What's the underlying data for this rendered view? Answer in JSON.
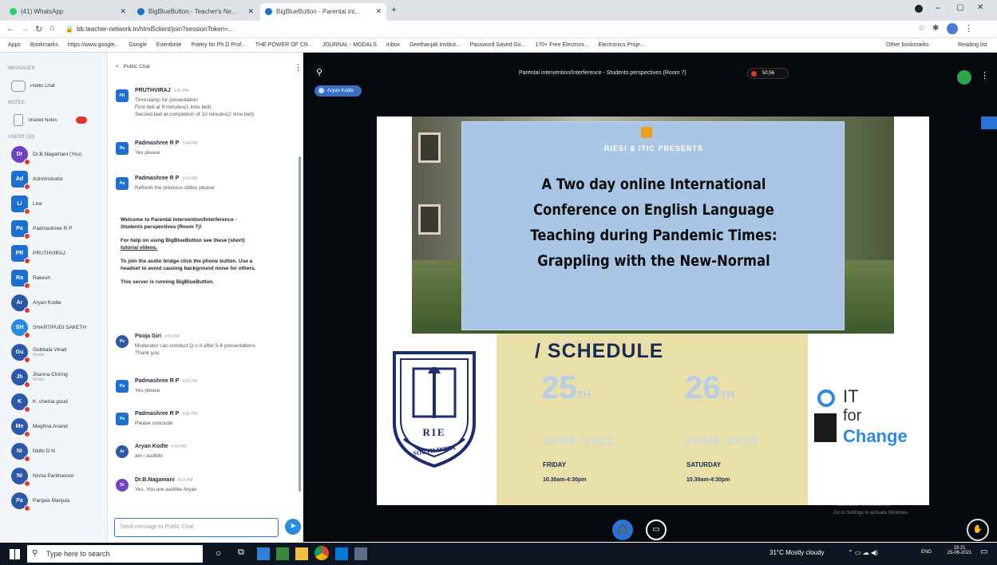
{
  "browser": {
    "tabs": [
      {
        "title": "(41) WhatsApp",
        "icon": "whatsapp-icon"
      },
      {
        "title": "BigBlueButton - Teacher's Ne...",
        "icon": "bbb-icon"
      },
      {
        "title": "BigBlueButton - Parental int...",
        "icon": "bbb-icon"
      }
    ],
    "url": "bb.teacher-network.in/html5client/join?sessionToken=...",
    "bookmarks": [
      "Apps",
      "Bookmarks",
      "https://www.google...",
      "Google",
      "Eventbrite",
      "Poetry for Ph.D Prof...",
      "THE POWER OF CR...",
      "JOURNAL - MODALS",
      "Inbox",
      "Geethanjali Institut...",
      "Password Saved Go...",
      "170+ Free Electroni...",
      "Electronics Proje...",
      "Other bookmarks",
      "Reading list"
    ]
  },
  "sidebar": {
    "messages_heading": "MESSAGES",
    "public_chat": "Public Chat",
    "notes_heading": "NOTES",
    "shared_notes": "Shared Notes",
    "users_heading": "USERS (19)",
    "users": [
      {
        "initials": "Dr",
        "name": "Dr.B.Nagamani (You)",
        "color": "#6f42c1",
        "round": true,
        "sub": ""
      },
      {
        "initials": "Ad",
        "name": "Administrator",
        "color": "#1d6fd1",
        "round": false,
        "sub": ""
      },
      {
        "initials": "Li",
        "name": "Live",
        "color": "#1d6fd1",
        "round": false,
        "sub": ""
      },
      {
        "initials": "Pa",
        "name": "Padmashree R P",
        "color": "#1d6fd1",
        "round": false,
        "sub": ""
      },
      {
        "initials": "PR",
        "name": "PRUTHVIRAJ",
        "color": "#1d6fd1",
        "round": false,
        "sub": ""
      },
      {
        "initials": "Ra",
        "name": "Rakesh",
        "color": "#1d6fd1",
        "round": false,
        "sub": ""
      },
      {
        "initials": "Ar",
        "name": "Aryan Kodte",
        "color": "#2b58a8",
        "round": true,
        "sub": ""
      },
      {
        "initials": "SH",
        "name": "SHARTIPUDI SAKETH",
        "color": "#2a8be0",
        "round": true,
        "sub": ""
      },
      {
        "initials": "Gu",
        "name": "Gubbala Vinati",
        "color": "#2b58a8",
        "round": true,
        "sub": "Mobile"
      },
      {
        "initials": "Jh",
        "name": "Jhanna Chiring",
        "color": "#2b58a8",
        "round": true,
        "sub": "Mobile"
      },
      {
        "initials": "K",
        "name": "K. chetna goud",
        "color": "#2b58a8",
        "round": true,
        "sub": ""
      },
      {
        "initials": "Me",
        "name": "Meghna Anand",
        "color": "#2b58a8",
        "round": true,
        "sub": ""
      },
      {
        "initials": "Ni",
        "name": "Nidhi D N",
        "color": "#2b58a8",
        "round": true,
        "sub": ""
      },
      {
        "initials": "Ni",
        "name": "Nisha Panthavoor",
        "color": "#2b58a8",
        "round": true,
        "sub": ""
      },
      {
        "initials": "Pa",
        "name": "Panjala Manjula",
        "color": "#2b58a8",
        "round": true,
        "sub": ""
      }
    ]
  },
  "chat": {
    "header": "Public Chat",
    "hide_label": "<",
    "messages_top": [
      {
        "initials": "PR",
        "name": "PRUTHVIRAJ",
        "time": "3:41 PM",
        "lines": [
          "Timestamp for presentation",
          "First bell at 9 minutes(1 time bell)",
          "Second bell at completion of 10 minutes(2 time bell)"
        ]
      },
      {
        "initials": "Pa",
        "name": "Padmashree R P",
        "time": "3:44 PM",
        "lines": [
          "Yes please"
        ]
      },
      {
        "initials": "Pa",
        "name": "Padmashree R P",
        "time": "3:54 PM",
        "lines": [
          "Refresh the previous slides please"
        ]
      }
    ],
    "welcome": {
      "line1": "Welcome to Parental intervention/Interference -",
      "line2": "Students perspectives (Room 7)!",
      "help1": "For help on using BigBlueButton see these (short)",
      "help2": "tutorial videos.",
      "audio1": "To join the audio bridge click the phone button. Use a",
      "audio2": "headset to avoid causing background noise for others.",
      "server": "This server is running BigBlueButton."
    },
    "messages_bottom": [
      {
        "initials": "Pu",
        "name": "Pooja Giri",
        "time": "4:00 PM",
        "lines": [
          "Moderator can conduct Q n A after 5-6 presentations",
          "Thank you"
        ],
        "round": true,
        "color": "#2b58a8"
      },
      {
        "initials": "Pa",
        "name": "Padmashree R P",
        "time": "4:01 PM",
        "lines": [
          "Yes please"
        ],
        "round": false,
        "color": "#1d6fd1"
      },
      {
        "initials": "Pa",
        "name": "Padmashree R P",
        "time": "4:01 PM",
        "lines": [
          "Please conclude"
        ],
        "round": false,
        "color": "#1d6fd1"
      },
      {
        "initials": "Ar",
        "name": "Aryan Kodte",
        "time": "4:03 PM",
        "lines": [
          "am i audible"
        ],
        "round": true,
        "color": "#2b58a8"
      },
      {
        "initials": "Dr",
        "name": "Dr.B.Nagamani",
        "time": "4:03 PM",
        "lines": [
          "Yes. You are audible Aryan"
        ],
        "round": true,
        "color": "#6f42c1"
      }
    ],
    "input_placeholder": "Send message to Public Chat"
  },
  "meeting": {
    "title": "Parental intervention/Interference - Students perspectives (Room 7)",
    "recording_time": "50:56",
    "presenter_badge": "Aryan Kodte"
  },
  "slide": {
    "presents": "RIESI & ITIC PRESENTS",
    "title_lines": [
      "A Two day online International",
      "Conference on English Language",
      "Teaching during Pandemic Times:",
      "Grappling with the New-Normal"
    ],
    "schedule_heading": "/ SCHEDULE",
    "day1_num": "25",
    "day1_suffix": "TH",
    "day1_month": "JUNE 2021",
    "day1_weekday": "FRIDAY",
    "day1_time": "10.30am-4:30pm",
    "day2_num": "26",
    "day2_suffix": "TH",
    "day2_month": "JUNE 2021",
    "day2_weekday": "SATURDAY",
    "day2_time": "10.30am-4:30pm",
    "rie_text": "RIE",
    "rie_sub": "SOUTH INDIA",
    "itc_it": "IT",
    "itc_for": "for",
    "itc_change": "Change"
  },
  "overlay": {
    "activate": "Activate Windows",
    "activate_sub": "Go to Settings to activate Windows."
  },
  "taskbar": {
    "search_placeholder": "Type here to search",
    "weather": "31°C  Mostly cloudy",
    "lang": "ENG",
    "time": "15:21",
    "date": "25-06-2021"
  }
}
